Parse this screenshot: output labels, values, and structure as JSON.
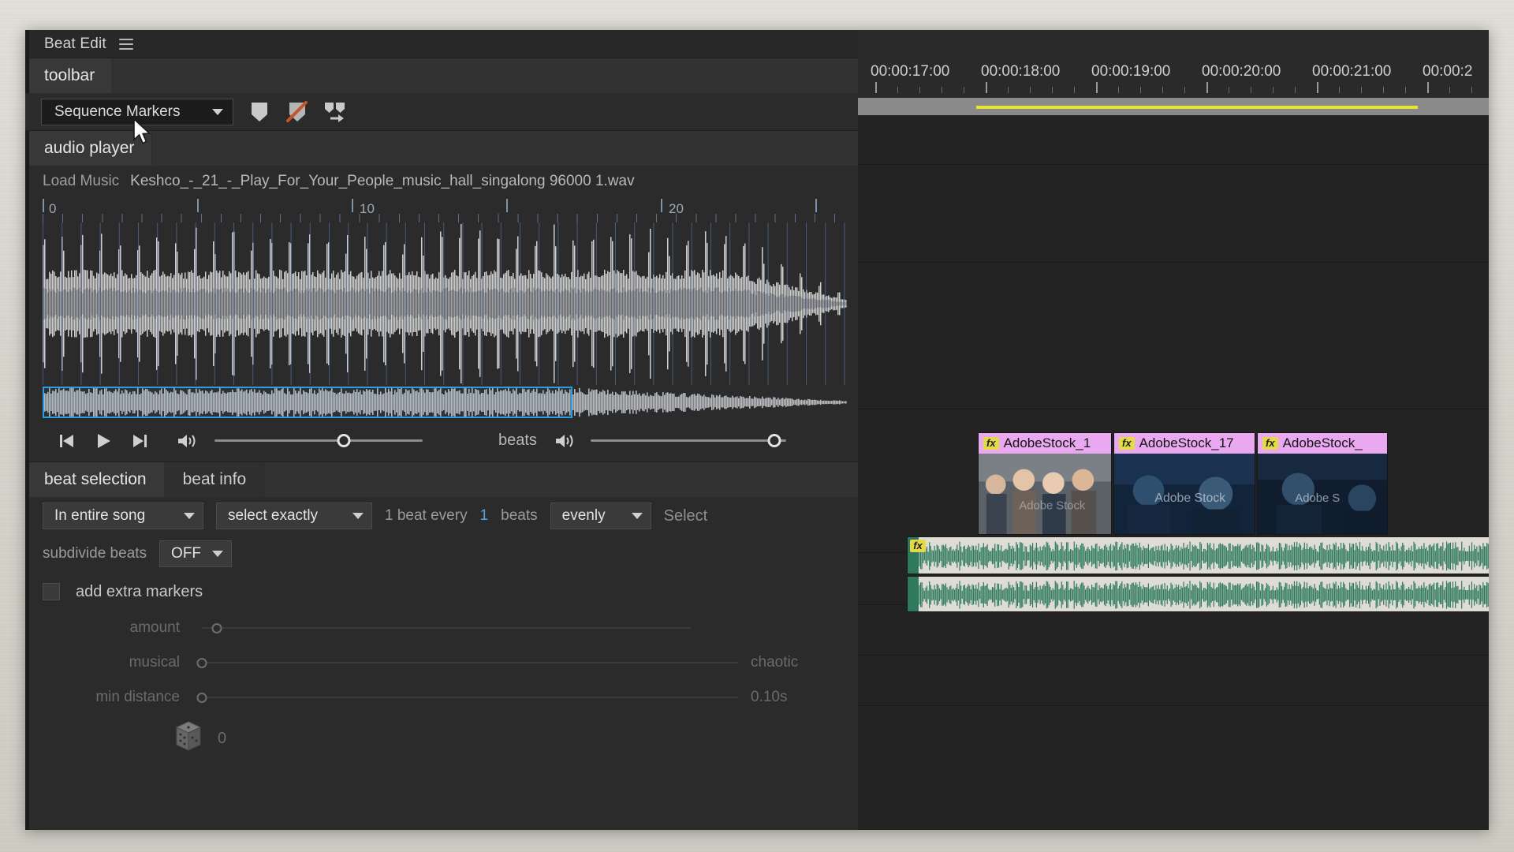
{
  "panel": {
    "title": "Beat Edit",
    "menu_icon": "hamburger-icon"
  },
  "toolbar": {
    "section_label": "toolbar",
    "marker_source": "Sequence Markers",
    "icons": [
      {
        "name": "add-marker-icon",
        "label": "Add Marker"
      },
      {
        "name": "delete-marker-icon",
        "label": "Delete Markers"
      },
      {
        "name": "move-markers-icon",
        "label": "Move Markers"
      }
    ]
  },
  "audio_player": {
    "section_label": "audio player",
    "load_button": "Load Music",
    "filename": "Keshco_-_21_-_Play_For_Your_People_music_hall_singalong 96000 1.wav",
    "ruler_labels": [
      "0",
      "10",
      "20"
    ],
    "transport": {
      "skip_start": "skip-to-start",
      "play": "play",
      "skip_end": "skip-to-end",
      "volume_icon": "speaker-icon",
      "volume_value": 62,
      "beats_label": "beats",
      "beats_volume_icon": "speaker-icon",
      "beats_volume_value": 94
    }
  },
  "beat_selection": {
    "tabs": [
      {
        "label": "beat selection",
        "active": true
      },
      {
        "label": "beat info",
        "active": false
      }
    ],
    "scope": "In entire song",
    "mode": "select exactly",
    "every_prefix": "1 beat every",
    "every_value": "1",
    "every_suffix": "beats",
    "distribution": "evenly",
    "select_button": "Select",
    "subdivide_label": "subdivide beats",
    "subdivide_value": "OFF",
    "extra_markers_label": "add extra markers",
    "extra_markers_checked": false,
    "sliders": [
      {
        "label": "amount",
        "right_label": "",
        "value": 3
      },
      {
        "label": "musical",
        "right_label": "chaotic",
        "value": 0
      },
      {
        "label": "min distance",
        "right_label": "0.10s",
        "value": 0
      }
    ],
    "seed_icon": "dice-icon",
    "seed_value": "0"
  },
  "timeline": {
    "timecodes": [
      "00:00:17:00",
      "00:00:18:00",
      "00:00:19:00",
      "00:00:20:00",
      "00:00:21:00",
      "00:00:2"
    ],
    "video_clips": [
      {
        "name": "AdobeStock_1",
        "fx": "fx",
        "watermark": "Adobe Stock"
      },
      {
        "name": "AdobeStock_17",
        "fx": "fx",
        "watermark": "Adobe Stock"
      },
      {
        "name": "AdobeStock_",
        "fx": "fx",
        "watermark": "Adobe S"
      }
    ],
    "audio_clips": [
      {
        "fx": "fx"
      },
      {
        "fx": ""
      }
    ]
  },
  "colors": {
    "accent_blue": "#4fa6e8",
    "selection_blue": "#2e9ce0",
    "clip_pink": "#e9a8ef",
    "fx_yellow": "#e3da4a",
    "workbar_yellow": "#e9e432",
    "panel_bg": "#2b2b2b",
    "timeline_bg": "#232323",
    "audio_clip_green": "#2f7a5e"
  }
}
